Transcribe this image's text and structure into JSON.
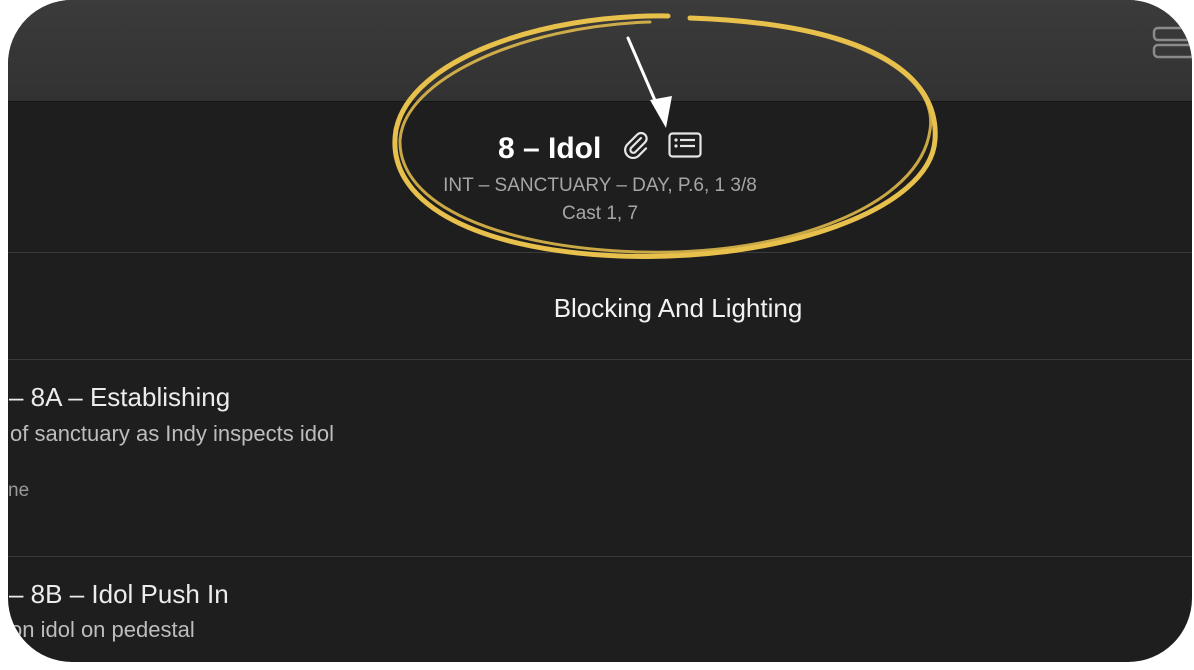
{
  "scene": {
    "title": "8 – Idol",
    "meta": "INT – SANCTUARY – DAY, P.6, 1 3/8",
    "cast": "Cast 1, 7"
  },
  "section": {
    "title": "Blocking And Lighting"
  },
  "shots": [
    {
      "title": "– 8A – Establishing",
      "description": "of sanctuary as Indy inspects idol",
      "extra": "ne"
    },
    {
      "title": "– 8B – Idol Push In",
      "description": "on idol on pedestal"
    }
  ],
  "colors": {
    "background": "#1e1e1e",
    "toolbar": "#373737",
    "highlight_circle": "#e8c14c",
    "annotation_arrow": "#ffffff"
  },
  "icons": [
    "paperclip-icon",
    "script-card-icon",
    "sidebar-toggle-icon",
    "annotation-arrow"
  ]
}
